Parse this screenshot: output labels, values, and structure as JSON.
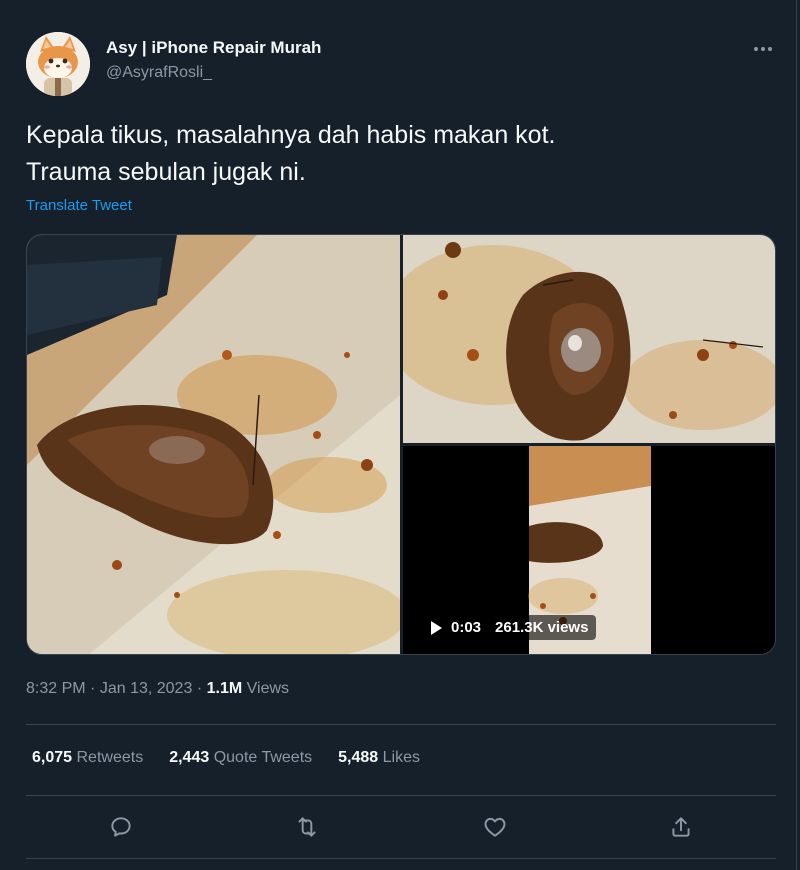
{
  "author": {
    "name": "Asy | iPhone Repair Murah",
    "handle": "@AsyrafRosli_"
  },
  "tweet": {
    "text": "Kepala tikus, masalahnya dah habis makan kot.\nTrauma sebulan jugak ni.",
    "translate_label": "Translate Tweet"
  },
  "media": {
    "video": {
      "duration": "0:03",
      "views": "261.3K views"
    }
  },
  "meta": {
    "time": "8:32 PM",
    "separator": "·",
    "date": "Jan 13, 2023",
    "views_count": "1.1M",
    "views_label": "Views"
  },
  "stats": [
    {
      "count": "6,075",
      "label": "Retweets"
    },
    {
      "count": "2,443",
      "label": "Quote Tweets"
    },
    {
      "count": "5,488",
      "label": "Likes"
    }
  ],
  "actions": [
    "reply-icon",
    "retweet-icon",
    "like-icon",
    "share-icon"
  ],
  "colors": {
    "background": "#15202b",
    "text_primary": "#f7f9f9",
    "text_secondary": "#8b98a5",
    "link": "#1d9bf0",
    "border": "#38444d"
  }
}
